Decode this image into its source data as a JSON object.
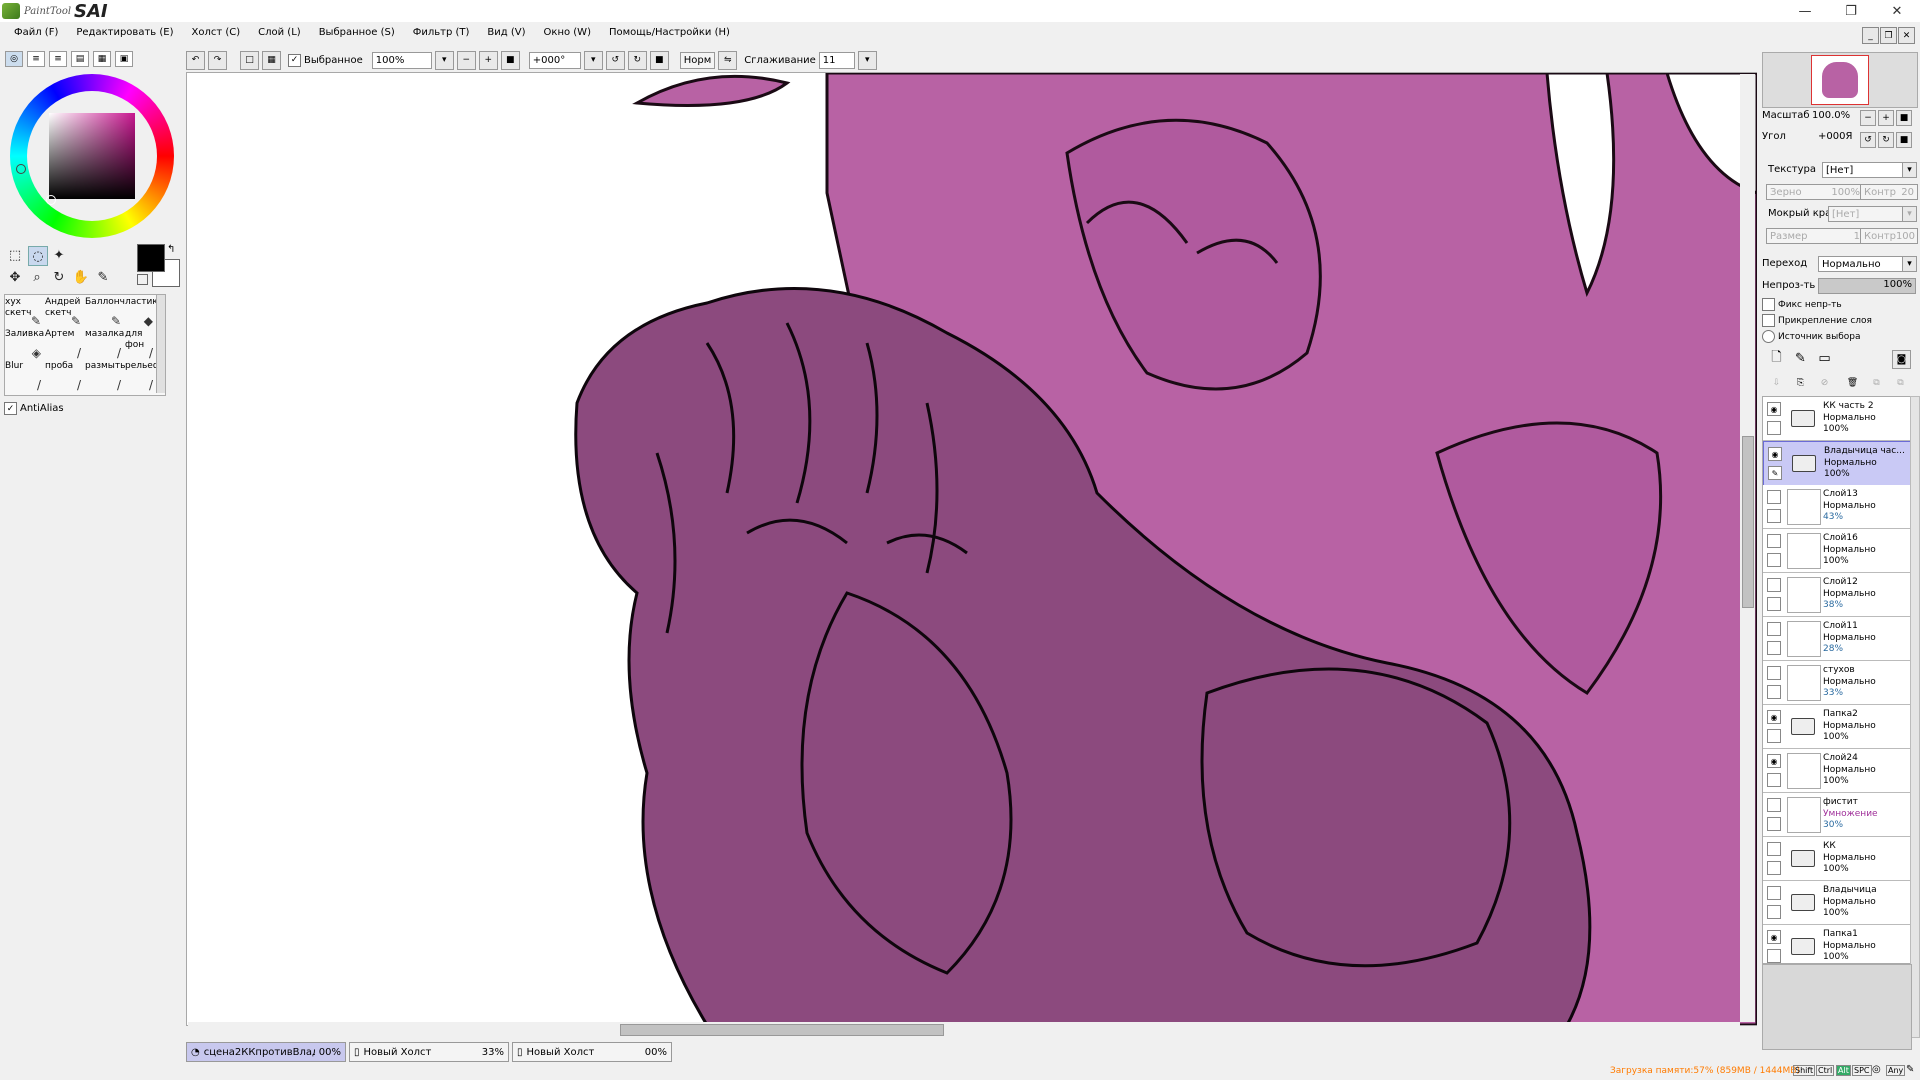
{
  "app": {
    "title_small": "PaintTool",
    "title_big": "SAI"
  },
  "window_controls": {
    "minimize": "—",
    "maximize": "❐",
    "close": "✕"
  },
  "menu": [
    "Файл (F)",
    "Редактировать (E)",
    "Холст (C)",
    "Слой (L)",
    "Выбранное (S)",
    "Фильтр (T)",
    "Вид (V)",
    "Окно (W)",
    "Помощь/Настройки (H)"
  ],
  "toolbar": {
    "selection_label": "Выбранное",
    "zoom": "100%",
    "angle": "+000°",
    "mode_label": "Норм",
    "stabilizer_label": "Сглаживание",
    "stabilizer_value": "11"
  },
  "brushes": [
    {
      "name": "хух скетч"
    },
    {
      "name": "Андрей скетч"
    },
    {
      "name": "Баллончик"
    },
    {
      "name": "ластик"
    },
    {
      "name": "Заливка"
    },
    {
      "name": "Артем"
    },
    {
      "name": "мазалка"
    },
    {
      "name": "для фон"
    },
    {
      "name": "Blur"
    },
    {
      "name": "проба"
    },
    {
      "name": "размыть"
    },
    {
      "name": "рельеф"
    }
  ],
  "antialias_label": "AntiAlias",
  "navigator": {
    "scale_label": "Масштаб",
    "scale_value": "100.0%",
    "angle_label": "Угол",
    "angle_value": "+000Я"
  },
  "layer_props": {
    "texture_label": "Текстура",
    "texture_value": "[Нет]",
    "grain_label": "Зерно",
    "grain_value": "100%",
    "contrast_label": "Контр",
    "contrast_value": "20",
    "wet_edge_label": "Мокрый край",
    "wet_edge_value": "[Нет]",
    "size_label": "Размер",
    "size_value": "1",
    "contrast2_label": "Контр",
    "contrast2_value": "100",
    "blend_label": "Переход",
    "blend_value": "Нормально",
    "opacity_label": "Непроз-ть",
    "opacity_value": "100%",
    "opacity_fraction": 1.0,
    "fix_opacity_label": "Фикс непр-ть",
    "clip_label": "Прикрепление слоя",
    "selection_source_label": "Источник выбора"
  },
  "layers": [
    {
      "name": "КК часть 2",
      "mode": "Нормально",
      "opacity": "100%",
      "type": "folder",
      "visible": true,
      "selected": false
    },
    {
      "name": "Владычица час...",
      "mode": "Нормально",
      "opacity": "100%",
      "type": "folder",
      "visible": true,
      "selected": true
    },
    {
      "name": "Слой13",
      "mode": "Нормально",
      "opacity": "43%",
      "type": "layer",
      "visible": false,
      "selected": false
    },
    {
      "name": "Слой16",
      "mode": "Нормально",
      "opacity": "100%",
      "type": "layer",
      "visible": false,
      "selected": false
    },
    {
      "name": "Слой12",
      "mode": "Нормально",
      "opacity": "38%",
      "type": "layer",
      "visible": false,
      "selected": false
    },
    {
      "name": "Слой11",
      "mode": "Нормально",
      "opacity": "28%",
      "type": "layer",
      "visible": false,
      "selected": false
    },
    {
      "name": "стухов",
      "mode": "Нормально",
      "opacity": "33%",
      "type": "layer",
      "visible": false,
      "selected": false
    },
    {
      "name": "Папка2",
      "mode": "Нормально",
      "opacity": "100%",
      "type": "folder",
      "visible": true,
      "selected": false
    },
    {
      "name": "Слой24",
      "mode": "Нормально",
      "opacity": "100%",
      "type": "layer",
      "visible": true,
      "selected": false
    },
    {
      "name": "фистит",
      "mode": "Умножение",
      "opacity": "30%",
      "type": "layer",
      "visible": false,
      "selected": false
    },
    {
      "name": "КК",
      "mode": "Нормально",
      "opacity": "100%",
      "type": "folder",
      "visible": false,
      "selected": false
    },
    {
      "name": "Владычица",
      "mode": "Нормально",
      "opacity": "100%",
      "type": "folder",
      "visible": false,
      "selected": false
    },
    {
      "name": "Папка1",
      "mode": "Нормально",
      "opacity": "100%",
      "type": "folder",
      "visible": true,
      "selected": false
    }
  ],
  "canvas_tabs": [
    {
      "name": "сцена2ККпротивВлад...",
      "zoom": "00%",
      "active": true
    },
    {
      "name": "Новый Холст",
      "zoom": "33%",
      "active": false
    },
    {
      "name": "Новый Холст",
      "zoom": "00%",
      "active": false
    }
  ],
  "status": {
    "memory": "Загрузка памяти:57% (859MB / 1444MB)",
    "keys": [
      "Shift",
      "Ctrl",
      "Alt",
      "SPC",
      "Any"
    ]
  },
  "colors": {
    "accent": "#b05a9e",
    "selected_layer": "#c9c9f5",
    "canvas_fill": "#b862a4",
    "figure_fill": "#8c4a7e",
    "memory_text": "#ff7b00"
  }
}
